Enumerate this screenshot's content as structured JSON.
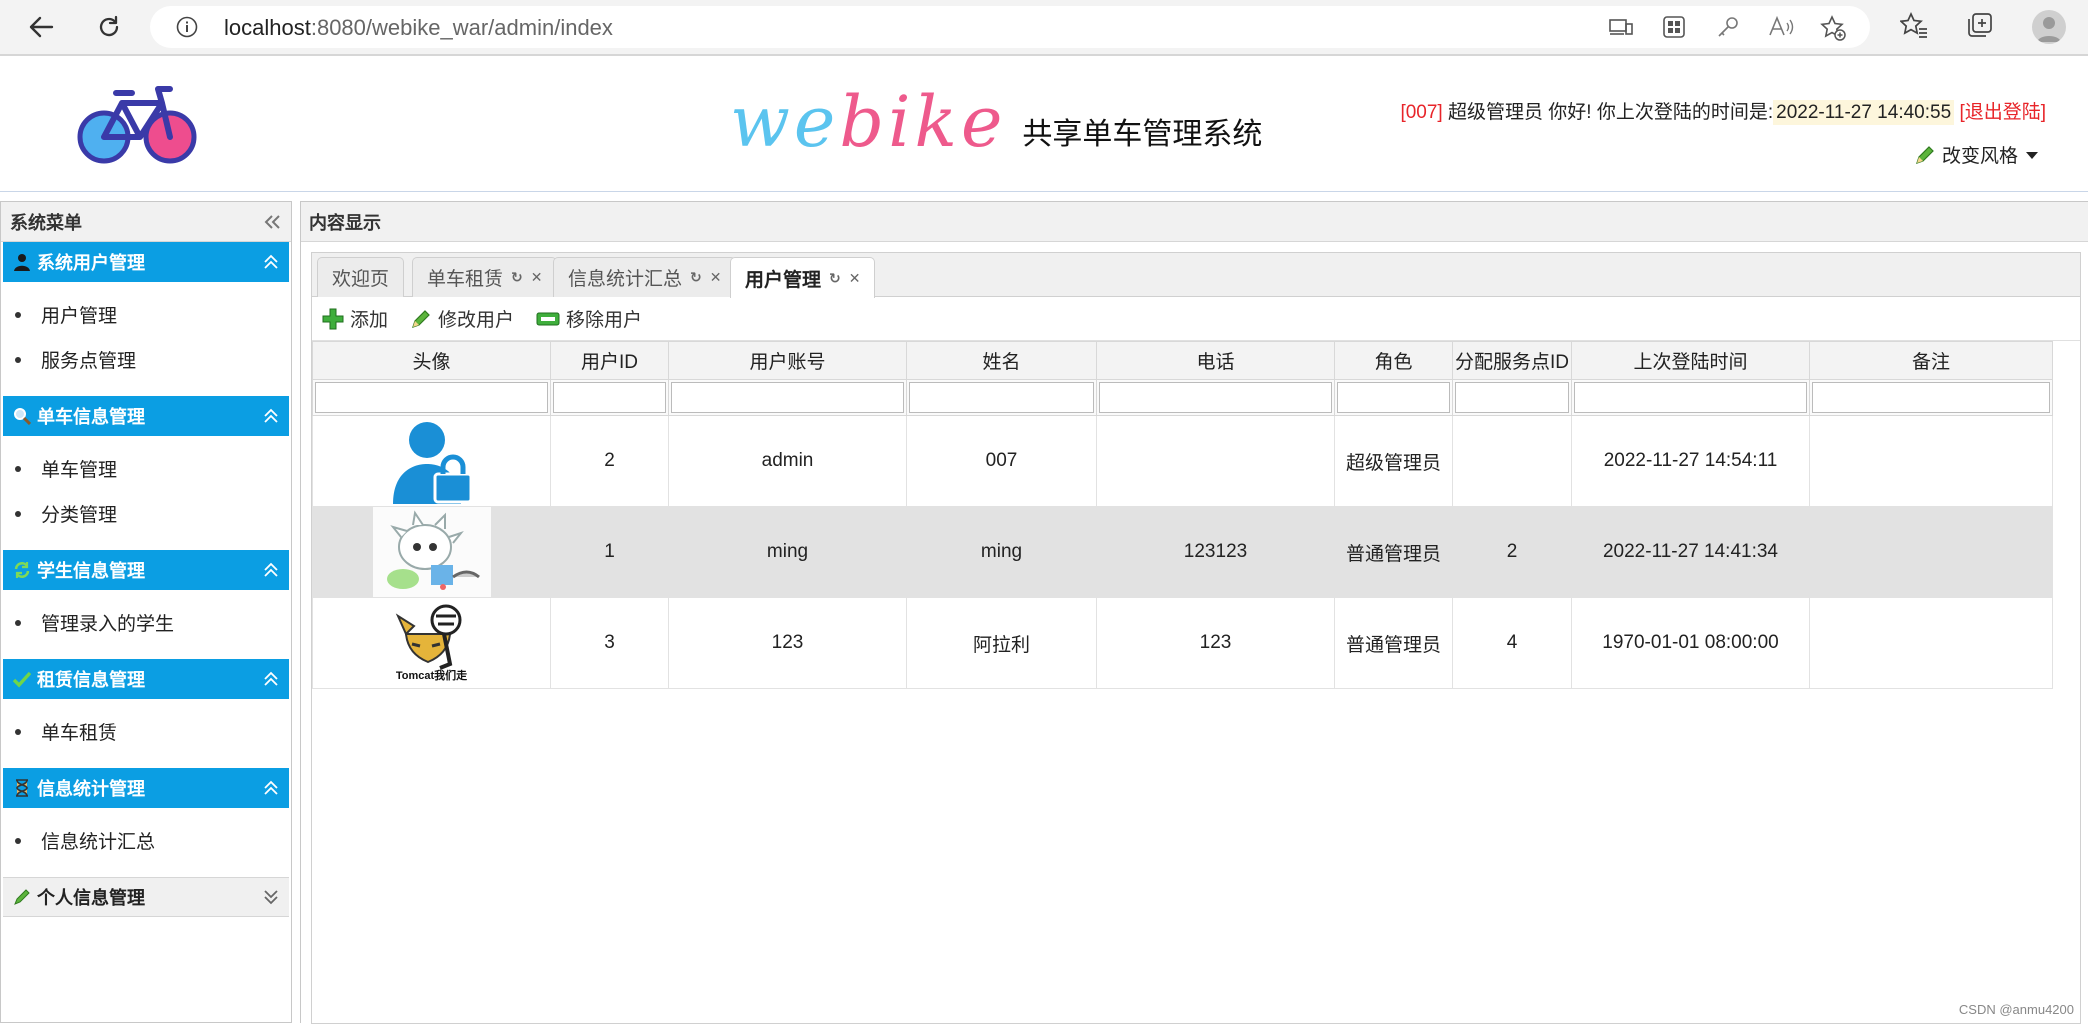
{
  "browser": {
    "url_host": "localhost",
    "url_path": ":8080/webike_war/admin/index"
  },
  "header": {
    "brand_en_1": "we",
    "brand_en_2": "bike",
    "brand_cn": "共享单车管理系统",
    "welcome_id": "[007]",
    "welcome_text": " 超级管理员 你好! 你上次登陆的时间是:",
    "last_login": "2022-11-27 14:40:55",
    "logout": "[退出登陆]",
    "change_style": "改变风格"
  },
  "sidebar": {
    "title": "系统菜单",
    "groups": [
      {
        "label": "系统用户管理",
        "icon": "user-icon",
        "items": [
          "用户管理",
          "服务点管理"
        ]
      },
      {
        "label": "单车信息管理",
        "icon": "search-icon",
        "items": [
          "单车管理",
          "分类管理"
        ]
      },
      {
        "label": "学生信息管理",
        "icon": "refresh-icon",
        "items": [
          "管理录入的学生"
        ]
      },
      {
        "label": "租赁信息管理",
        "icon": "check-icon",
        "items": [
          "单车租赁"
        ]
      },
      {
        "label": "信息统计管理",
        "icon": "hourglass-icon",
        "items": [
          "信息统计汇总"
        ]
      },
      {
        "label": "个人信息管理",
        "icon": "pencil-icon",
        "items": []
      }
    ]
  },
  "content": {
    "title": "内容显示",
    "tabs": [
      {
        "label": "欢迎页"
      },
      {
        "label": "单车租赁"
      },
      {
        "label": "信息统计汇总"
      },
      {
        "label": "用户管理"
      }
    ],
    "toolbar": {
      "add": "添加",
      "edit": "修改用户",
      "remove": "移除用户"
    },
    "columns": [
      "头像",
      "用户ID",
      "用户账号",
      "姓名",
      "电话",
      "角色",
      "分配服务点ID",
      "上次登陆时间",
      "备注"
    ],
    "rows": [
      {
        "avatar": "user-lock-avatar",
        "id": "2",
        "account": "admin",
        "name": "007",
        "phone": "",
        "role": "超级管理员",
        "point": "",
        "last": "2022-11-27 14:54:11",
        "note": ""
      },
      {
        "avatar": "cartoon-avatar",
        "id": "1",
        "account": "ming",
        "name": "ming",
        "phone": "123123",
        "role": "普通管理员",
        "point": "2",
        "last": "2022-11-27 14:41:34",
        "note": ""
      },
      {
        "avatar": "tomcat-avatar",
        "id": "3",
        "account": "123",
        "name": "阿拉利",
        "phone": "123",
        "role": "普通管理员",
        "point": "4",
        "last": "1970-01-01 08:00:00",
        "note": ""
      }
    ],
    "tomcat_caption": "Tomcat我们走"
  },
  "watermark": "CSDN @anmu4200"
}
